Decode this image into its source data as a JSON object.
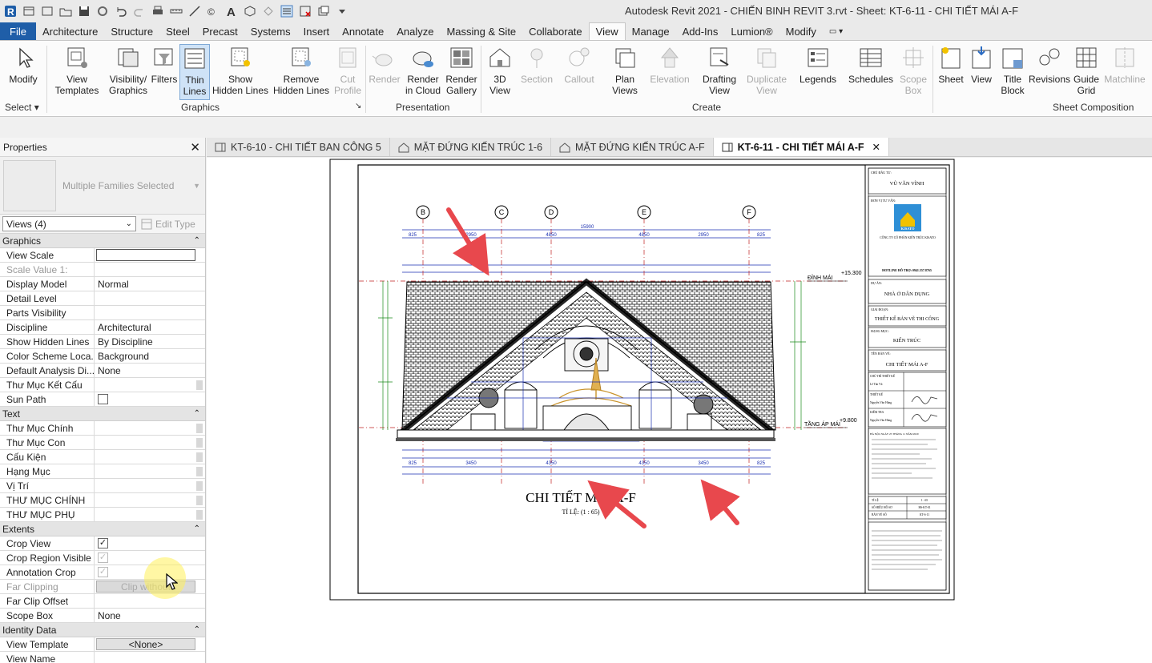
{
  "window": {
    "title": "Autodesk Revit 2021 - CHIẾN BINH REVIT 3.rvt - Sheet: KT-6-11 - CHI TIẾT MÁI A-F"
  },
  "quick_access": {
    "icons": [
      "revit-logo-icon",
      "open-icon",
      "save-icon",
      "sync-icon",
      "undo-icon",
      "redo-icon",
      "print-icon",
      "measure-icon",
      "dimension-icon",
      "tag-icon",
      "text-icon",
      "3d-view-icon",
      "section-icon",
      "thin-lines-icon",
      "close-hidden-icon",
      "switch-windows-icon",
      "customize-icon"
    ]
  },
  "ribbon_tabs": [
    {
      "label": "File"
    },
    {
      "label": "Architecture"
    },
    {
      "label": "Structure"
    },
    {
      "label": "Steel"
    },
    {
      "label": "Precast"
    },
    {
      "label": "Systems"
    },
    {
      "label": "Insert"
    },
    {
      "label": "Annotate"
    },
    {
      "label": "Analyze"
    },
    {
      "label": "Massing & Site"
    },
    {
      "label": "Collaborate"
    },
    {
      "label": "View"
    },
    {
      "label": "Manage"
    },
    {
      "label": "Add-Ins"
    },
    {
      "label": "Lumion®"
    },
    {
      "label": "Modify"
    }
  ],
  "ribbon": {
    "buttons": [
      {
        "l1": "Modify",
        "l2": ""
      },
      {
        "l1": "View",
        "l2": "Templates"
      },
      {
        "l1": "Visibility/",
        "l2": "Graphics"
      },
      {
        "l1": "Filters",
        "l2": ""
      },
      {
        "l1": "Thin",
        "l2": "Lines"
      },
      {
        "l1": "Show",
        "l2": "Hidden Lines"
      },
      {
        "l1": "Remove",
        "l2": "Hidden Lines"
      },
      {
        "l1": "Cut",
        "l2": "Profile"
      },
      {
        "l1": "Render",
        "l2": ""
      },
      {
        "l1": "Render",
        "l2": "in Cloud"
      },
      {
        "l1": "Render",
        "l2": "Gallery"
      },
      {
        "l1": "3D",
        "l2": "View"
      },
      {
        "l1": "Section",
        "l2": ""
      },
      {
        "l1": "Callout",
        "l2": ""
      },
      {
        "l1": "Plan",
        "l2": "Views"
      },
      {
        "l1": "Elevation",
        "l2": ""
      },
      {
        "l1": "Drafting",
        "l2": "View"
      },
      {
        "l1": "Duplicate",
        "l2": "View"
      },
      {
        "l1": "Legends",
        "l2": ""
      },
      {
        "l1": "Schedules",
        "l2": ""
      },
      {
        "l1": "Scope",
        "l2": "Box"
      },
      {
        "l1": "Sheet",
        "l2": ""
      },
      {
        "l1": "View",
        "l2": ""
      },
      {
        "l1": "Title",
        "l2": "Block"
      },
      {
        "l1": "Revisions",
        "l2": ""
      },
      {
        "l1": "Guide",
        "l2": "Grid"
      },
      {
        "l1": "Matchline",
        "l2": ""
      }
    ],
    "groups": {
      "select": "Select",
      "graphics": "Graphics",
      "presentation": "Presentation",
      "create": "Create",
      "sheet_composition": "Sheet Composition"
    }
  },
  "properties": {
    "title": "Properties",
    "type_name": "Multiple Families Selected",
    "views_selector": "Views (4)",
    "edit_type": "Edit Type",
    "sections": [
      {
        "name": "Graphics",
        "rows": [
          {
            "label": "View Scale",
            "value": ""
          },
          {
            "label": "Scale Value    1:",
            "value": ""
          },
          {
            "label": "Display Model",
            "value": "Normal"
          },
          {
            "label": "Detail Level",
            "value": ""
          },
          {
            "label": "Parts Visibility",
            "value": ""
          },
          {
            "label": "Discipline",
            "value": "Architectural"
          },
          {
            "label": "Show Hidden Lines",
            "value": "By Discipline"
          },
          {
            "label": "Color Scheme Loca...",
            "value": "Background"
          },
          {
            "label": "Default Analysis Di...",
            "value": "None"
          },
          {
            "label": "Thư Mục Kết Cấu",
            "value": ""
          },
          {
            "label": "Sun Path",
            "value": ""
          }
        ]
      },
      {
        "name": "Text",
        "rows": [
          {
            "label": "Thư Mục Chính",
            "value": ""
          },
          {
            "label": "Thư Mục Con",
            "value": ""
          },
          {
            "label": "Cấu Kiện",
            "value": ""
          },
          {
            "label": "Hạng Mục",
            "value": ""
          },
          {
            "label": "Vị Trí",
            "value": ""
          },
          {
            "label": "THƯ MỤC CHÍNH",
            "value": ""
          },
          {
            "label": "THƯ MỤC PHỤ",
            "value": ""
          }
        ]
      },
      {
        "name": "Extents",
        "rows": [
          {
            "label": "Crop View",
            "value": ""
          },
          {
            "label": "Crop Region Visible",
            "value": ""
          },
          {
            "label": "Annotation Crop",
            "value": ""
          },
          {
            "label": "Far Clipping",
            "value": "Clip without"
          },
          {
            "label": "Far Clip Offset",
            "value": ""
          },
          {
            "label": "Scope Box",
            "value": "None"
          }
        ]
      },
      {
        "name": "Identity Data",
        "rows": [
          {
            "label": "View Template",
            "value": "<None>"
          },
          {
            "label": "View Name",
            "value": ""
          }
        ]
      }
    ]
  },
  "view_tabs": [
    {
      "label": "KT-6-10 - CHI TIẾT BAN CÔNG 5"
    },
    {
      "label": "MẶT ĐỨNG KIẾN TRÚC 1-6"
    },
    {
      "label": "MẶT ĐỨNG KIẾN TRÚC A-F"
    },
    {
      "label": "KT-6-11 - CHI TIẾT MÁI A-F"
    }
  ],
  "sheet": {
    "drawing_title": "CHI TIẾT MÁI A-F",
    "scale_note": "TỈ LỆ: (1 : 65)",
    "grid_bubbles": [
      "B",
      "C",
      "D",
      "E",
      "F"
    ],
    "level_top": "ĐỈNH MÁI",
    "level_top_elev": "+15.300",
    "level_bottom": "TẦNG ÁP MÁI",
    "level_bottom_elev": "+9.800",
    "dims_top": [
      "825",
      "2950",
      "4850",
      "4850",
      "2950",
      "825"
    ],
    "dims_bottom": [
      "825",
      "3450",
      "4350",
      "4350",
      "3450",
      "825"
    ],
    "titleblock": {
      "owner_label": "CHỦ ĐẦU TƯ:",
      "owner": "VŨ VĂN VĨNH",
      "consultant_label": "ĐƠN VỊ TƯ VẤN:",
      "company": "CÔNG TY CỔ PHẦN KIẾN TRÚC KISATO",
      "logo": "KISATO",
      "hotline": "HOTLINE HỖ TRỢ: 0941.557.8765",
      "project_label": "DỰ ÁN:",
      "project": "NHÀ Ở DÂN DỤNG",
      "phase_label": "GIAI ĐOẠN:",
      "phase": "THIẾT KẾ BẢN VẼ THI CÔNG",
      "category_label": "HẠNG MỤC:",
      "category": "KIẾN TRÚC",
      "drawing_label": "TÊN BẢN VẼ:",
      "drawing": "CHI TIẾT MÁI A-F",
      "role1": "CHỦ TRÌ THIẾT KẾ",
      "name1": "Lê Tấn Vũ",
      "role2": "THIẾT KẾ",
      "name2": "Nguyễn Văn Hùng",
      "role3": "KIỂM TRA",
      "name3": "Nguyễn Văn Hùng",
      "date": "HÀ NỘI, NGÀY 25 THÁNG 11 NĂM 2020",
      "scale_label": "TỈ LỆ",
      "scale": "1 : 65",
      "file_label": "SỐ HIỆU HỒ SƠ",
      "file": "HS-KT-01",
      "sheet_label": "BẢN VẼ SỐ",
      "sheet_no": "KT-6-11"
    }
  }
}
